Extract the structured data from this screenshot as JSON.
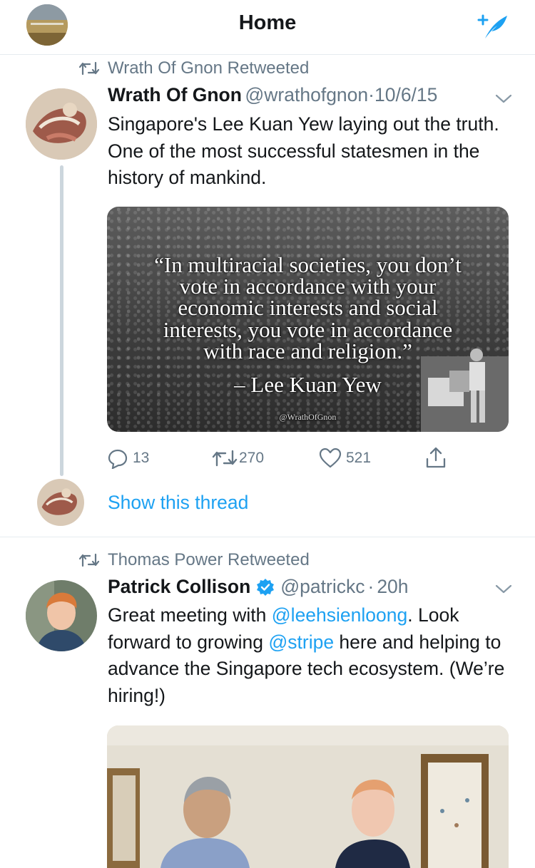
{
  "header": {
    "title": "Home",
    "avatar_icon": "profile-avatar",
    "compose_icon": "compose-tweet-icon",
    "accent": "#1da1f2"
  },
  "tweets": [
    {
      "retweeted_by": "Wrath Of Gnon Retweeted",
      "name": "Wrath Of Gnon",
      "handle": "@wrathofgnon",
      "dot": "·",
      "time": "10/6/15",
      "text": "Singapore's Lee Kuan Yew laying out the truth. One of the most successful statesmen in the history of mankind.",
      "quote_image": {
        "lines": [
          "“In multiracial societies, you don’t",
          "vote in accordance with your",
          "economic interests and social",
          "interests, you vote in accordance",
          "with race and religion.”"
        ],
        "author": "– Lee Kuan Yew",
        "watermark": "@WrathOfGnon"
      },
      "actions": {
        "replies": "13",
        "retweets": "270",
        "likes": "521"
      },
      "show_thread": "Show this thread"
    },
    {
      "retweeted_by": "Thomas Power Retweeted",
      "name": "Patrick Collison",
      "verified": true,
      "handle": "@patrickc",
      "dot": "·",
      "time": "20h",
      "text_parts": {
        "p1": "Great meeting with ",
        "mention1": "@leehsienloong",
        "p2": ". Look forward to growing ",
        "mention2": "@stripe",
        "p3": " here and helping to advance the Singapore tech ecosystem. (We’re hiring!)"
      }
    }
  ],
  "colors": {
    "text": "#14171a",
    "secondary": "#657786",
    "link": "#1da1f2",
    "divider": "#e6ecf0",
    "thread_line": "#ccd6dd"
  }
}
